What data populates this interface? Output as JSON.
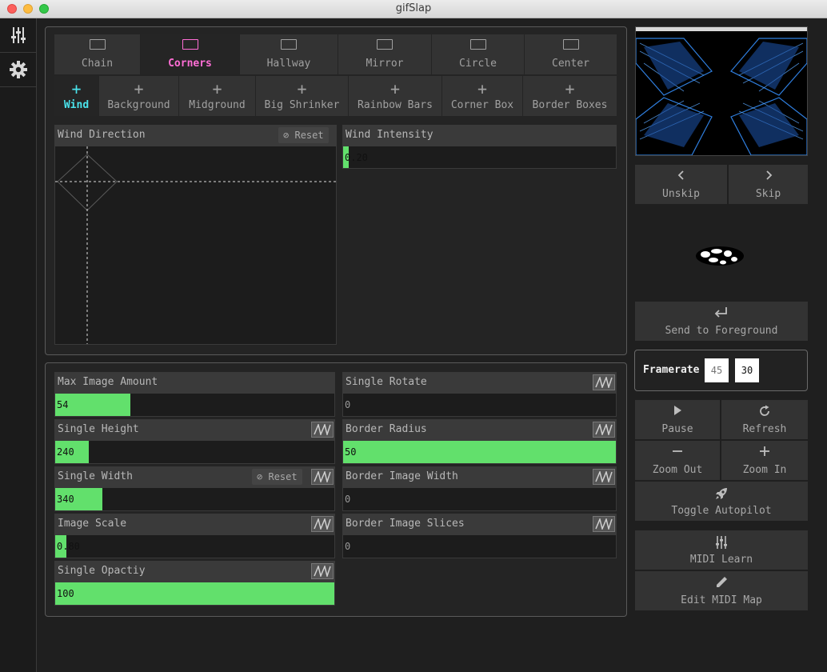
{
  "window": {
    "title": "gifSlap"
  },
  "sidebar": {
    "items": [
      {
        "icon": "sliders-icon"
      },
      {
        "icon": "gear-icon"
      }
    ]
  },
  "scenes": {
    "tabs": [
      "Chain",
      "Corners",
      "Hallway",
      "Mirror",
      "Circle",
      "Center"
    ],
    "selected": "Corners",
    "selected_color": "#ff6ed6"
  },
  "layers": {
    "tabs": [
      "Wind",
      "Background",
      "Midground",
      "Big Shrinker",
      "Rainbow Bars",
      "Corner Box",
      "Border Boxes"
    ],
    "selected": "Wind",
    "selected_color": "#4ae3ec"
  },
  "wind": {
    "direction_label": "Wind Direction",
    "reset_label": "Reset",
    "intensity_label": "Wind Intensity",
    "intensity_value": "0.20",
    "intensity_fraction": 0.02
  },
  "params": {
    "max_image_amount": {
      "label": "Max Image Amount",
      "value": "54",
      "fraction": 0.27
    },
    "single_height": {
      "label": "Single Height",
      "value": "240",
      "fraction": 0.12
    },
    "single_width": {
      "label": "Single Width",
      "value": "340",
      "fraction": 0.17,
      "reset_label": "Reset"
    },
    "image_scale": {
      "label": "Image Scale",
      "value": "0.80",
      "fraction": 0.04
    },
    "single_opacity": {
      "label": "Single Opactiy",
      "value": "100",
      "fraction": 1.0
    },
    "single_rotate": {
      "label": "Single Rotate",
      "value": "0",
      "fraction": 0
    },
    "border_radius": {
      "label": "Border Radius",
      "value": "50",
      "fraction": 1.0
    },
    "border_image_width": {
      "label": "Border Image Width",
      "value": "0",
      "fraction": 0
    },
    "border_image_slices": {
      "label": "Border Image Slices",
      "value": "0",
      "fraction": 0
    }
  },
  "right": {
    "unskip": "Unskip",
    "skip": "Skip",
    "send_to_foreground": "Send to Foreground",
    "framerate_label": "Framerate",
    "framerate_placeholder": "45",
    "framerate_value": "30",
    "pause": "Pause",
    "refresh": "Refresh",
    "zoom_out": "Zoom Out",
    "zoom_in": "Zoom In",
    "toggle_autopilot": "Toggle Autopilot",
    "midi_learn": "MIDI Learn",
    "edit_midi_map": "Edit MIDI Map"
  },
  "colors": {
    "accent_green": "#62e06c"
  }
}
